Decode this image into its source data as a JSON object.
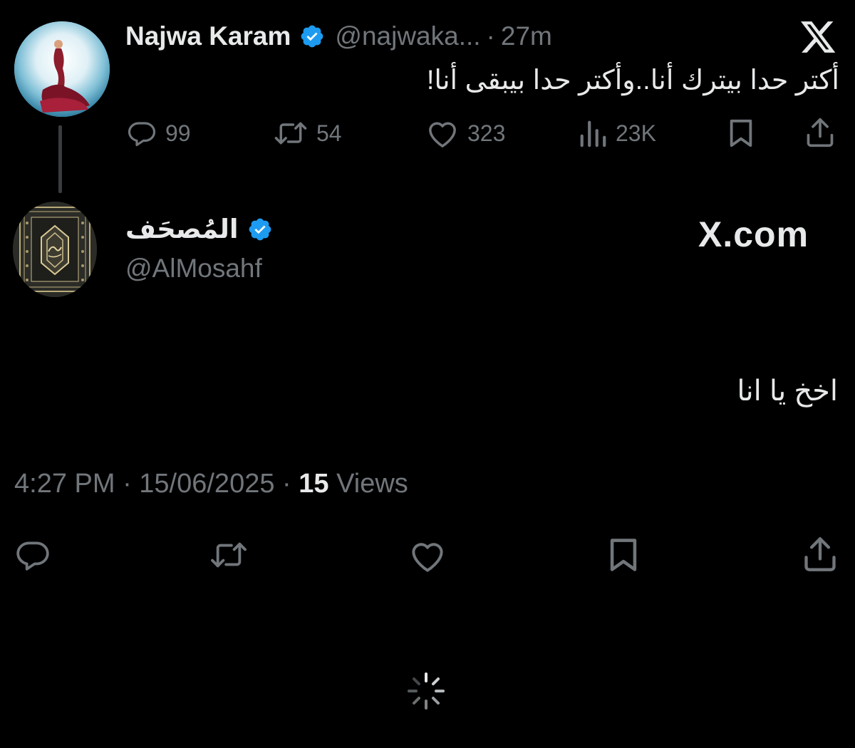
{
  "parent_tweet": {
    "display_name": "Najwa Karam",
    "handle": "@najwaka...",
    "separator": "·",
    "time_ago": "27m",
    "text": "أكتر حدا بيترك أنا..وأكتر حدا بيبقى أنا!",
    "actions": {
      "replies": "99",
      "reposts": "54",
      "likes": "323",
      "views": "23K"
    },
    "avatar_icon": "singer-avatar"
  },
  "reply_tweet": {
    "display_name": "المُصحَف",
    "handle": "@AlMosahf",
    "text": "اخخ يا انا",
    "timestamp": "4:27 PM · 15/06/2025 · ",
    "views_count": "15",
    "views_label": " Views",
    "avatar_icon": "quran-cover-avatar"
  },
  "branding": {
    "x_logo": "x-logo-icon",
    "watermark": "X.com"
  },
  "colors": {
    "background": "#000000",
    "text": "#e7e9ea",
    "muted": "#71767b",
    "verified": "#1d9bf0"
  }
}
